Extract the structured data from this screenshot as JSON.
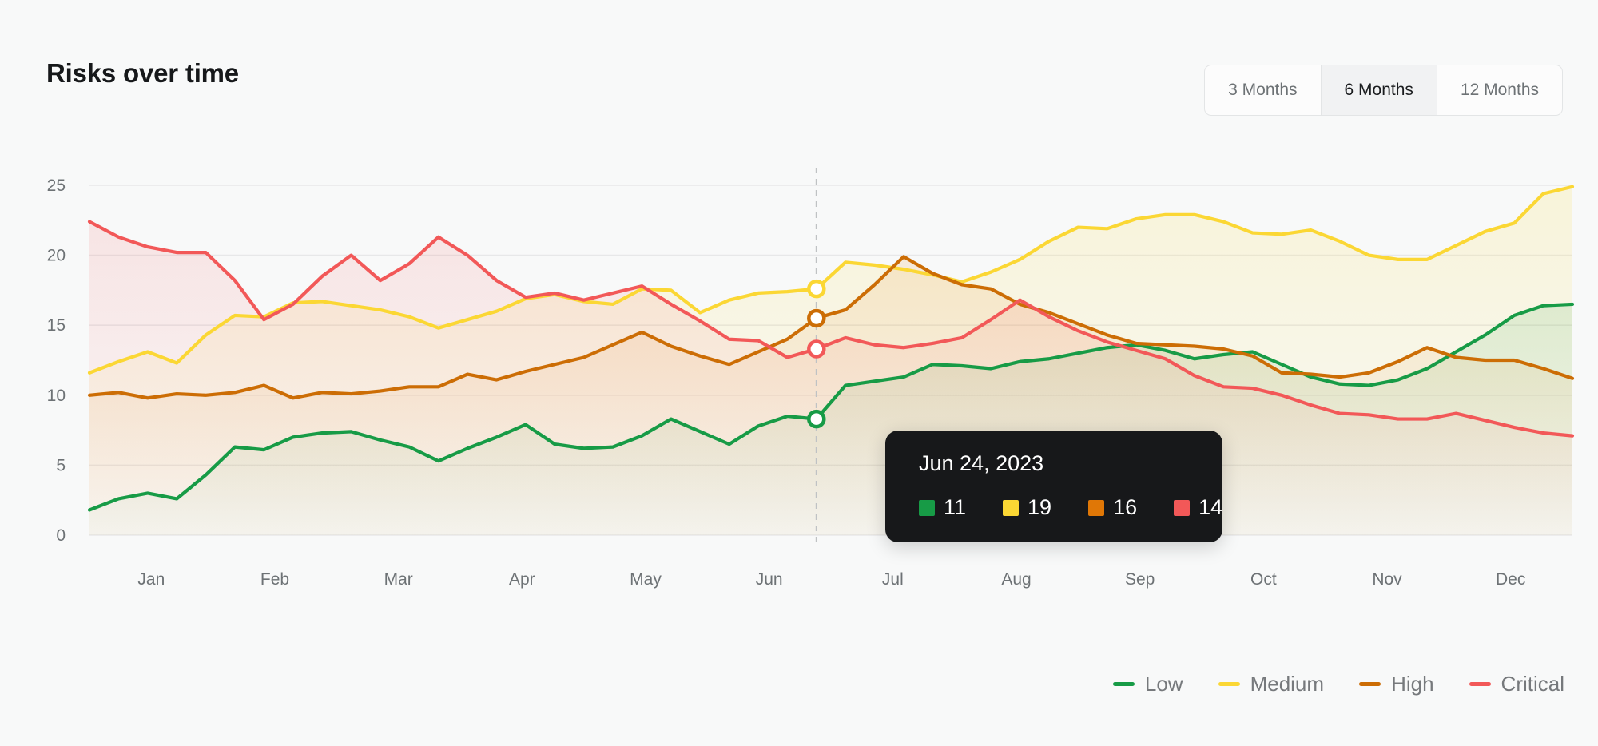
{
  "header": {
    "title": "Risks over time",
    "range_options": [
      {
        "label": "3 Months",
        "active": false
      },
      {
        "label": "6 Months",
        "active": true
      },
      {
        "label": "12 Months",
        "active": false
      }
    ]
  },
  "tooltip": {
    "date": "Jun 24, 2023",
    "items": [
      {
        "series": "Low",
        "value": "11",
        "color": "#179b46"
      },
      {
        "series": "Medium",
        "value": "19",
        "color": "#fbd734"
      },
      {
        "series": "High",
        "value": "16",
        "color": "#e07706"
      },
      {
        "series": "Critical",
        "value": "14",
        "color": "#f25858"
      }
    ]
  },
  "legend": {
    "items": [
      {
        "label": "Low",
        "color": "#179b46"
      },
      {
        "label": "Medium",
        "color": "#fbd734"
      },
      {
        "label": "High",
        "color": "#cc6d05"
      },
      {
        "label": "Critical",
        "color": "#f25858"
      }
    ]
  },
  "chart_data": {
    "type": "line",
    "title": "Risks over time",
    "xlabel": "",
    "ylabel": "",
    "ylim": [
      0,
      25
    ],
    "yticks": [
      0,
      5,
      10,
      15,
      20,
      25
    ],
    "grid": true,
    "legend_position": "bottom-right",
    "area_fill": true,
    "categories": [
      "Jan",
      "Feb",
      "Mar",
      "Apr",
      "May",
      "Jun",
      "Jul",
      "Aug",
      "Sep",
      "Oct",
      "Nov",
      "Dec"
    ],
    "x_tick_labels": [
      "Jan",
      "Feb",
      "Mar",
      "Apr",
      "May",
      "Jun",
      "Jul",
      "Aug",
      "Sep",
      "Oct",
      "Nov",
      "Dec"
    ],
    "point_count": 52,
    "hover": {
      "index": 25,
      "date": "Jun 24, 2023"
    },
    "series": [
      {
        "name": "Low",
        "color": "#179b46",
        "values": [
          1.8,
          2.6,
          3.0,
          2.6,
          4.3,
          6.3,
          6.1,
          7.0,
          7.3,
          7.4,
          6.8,
          6.3,
          5.3,
          6.2,
          7.0,
          7.9,
          6.5,
          6.2,
          6.3,
          7.1,
          8.3,
          7.4,
          6.5,
          7.8,
          8.5,
          8.3,
          10.7,
          11.0,
          11.3,
          12.2,
          12.1,
          11.9,
          12.4,
          12.6,
          13.0,
          13.4,
          13.6,
          13.2,
          12.6,
          12.9,
          13.1,
          12.2,
          11.3,
          10.8,
          10.7,
          11.1,
          11.9,
          13.1,
          14.3,
          15.7,
          16.4,
          16.5
        ]
      },
      {
        "name": "Medium",
        "color": "#fbd734",
        "values": [
          11.6,
          12.4,
          13.1,
          12.3,
          14.3,
          15.7,
          15.6,
          16.6,
          16.7,
          16.4,
          16.1,
          15.6,
          14.8,
          15.4,
          16.0,
          16.9,
          17.2,
          16.7,
          16.5,
          17.6,
          17.5,
          15.9,
          16.8,
          17.3,
          17.4,
          17.6,
          19.5,
          19.3,
          19.0,
          18.6,
          18.1,
          18.8,
          19.7,
          21.0,
          22.0,
          21.9,
          22.6,
          22.9,
          22.9,
          22.4,
          21.6,
          21.5,
          21.8,
          21.0,
          20.0,
          19.7,
          19.7,
          20.7,
          21.7,
          22.3,
          24.4,
          24.9
        ]
      },
      {
        "name": "High",
        "color": "#cc6d05",
        "values": [
          10.0,
          10.2,
          9.8,
          10.1,
          10.0,
          10.2,
          10.7,
          9.8,
          10.2,
          10.1,
          10.3,
          10.6,
          10.6,
          11.5,
          11.1,
          11.7,
          12.2,
          12.7,
          13.6,
          14.5,
          13.5,
          12.8,
          12.2,
          13.1,
          14.0,
          15.5,
          16.1,
          17.9,
          19.9,
          18.7,
          17.9,
          17.6,
          16.5,
          15.9,
          15.1,
          14.3,
          13.7,
          13.6,
          13.5,
          13.3,
          12.8,
          11.6,
          11.5,
          11.3,
          11.6,
          12.4,
          13.4,
          12.7,
          12.5,
          12.5,
          11.9,
          11.2
        ]
      },
      {
        "name": "Critical",
        "color": "#f25858",
        "values": [
          22.4,
          21.3,
          20.6,
          20.2,
          20.2,
          18.2,
          15.4,
          16.5,
          18.5,
          20.0,
          18.2,
          19.4,
          21.3,
          20.0,
          18.2,
          17.0,
          17.3,
          16.8,
          17.3,
          17.8,
          16.5,
          15.3,
          14.0,
          13.9,
          12.7,
          13.3,
          14.1,
          13.6,
          13.4,
          13.7,
          14.1,
          15.4,
          16.8,
          15.6,
          14.6,
          13.8,
          13.2,
          12.6,
          11.4,
          10.6,
          10.5,
          10.0,
          9.3,
          8.7,
          8.6,
          8.3,
          8.3,
          8.7,
          8.2,
          7.7,
          7.3,
          7.1
        ]
      }
    ]
  }
}
